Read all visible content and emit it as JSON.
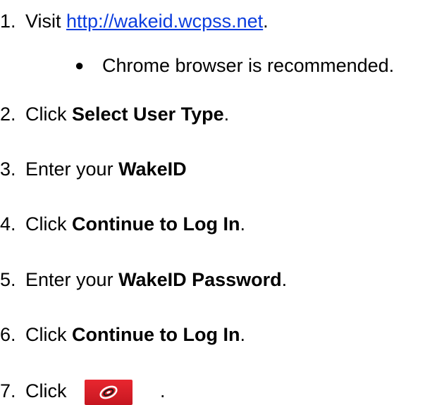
{
  "steps": [
    {
      "num": "1.",
      "pre": "Visit ",
      "link": "http://wakeid.wcpss.net",
      "post": "."
    },
    {
      "bullet": "Chrome browser is recommended."
    },
    {
      "num": "2.",
      "pre": "Click ",
      "bold": "Select User Type",
      "post": "."
    },
    {
      "num": "3.",
      "pre": "Enter your ",
      "bold": "WakeID",
      "post": ""
    },
    {
      "num": "4.",
      "pre": "Click ",
      "bold": "Continue to Log In",
      "post": "."
    },
    {
      "num": "5.",
      "pre": "Enter your ",
      "bold": "WakeID Password",
      "post": "."
    },
    {
      "num": "6.",
      "pre": "Click ",
      "bold": "Continue to Log In",
      "post": "."
    },
    {
      "num": "7.",
      "pre": "Click",
      "icon": "hurricanes-logo-icon",
      "post": "."
    }
  ],
  "colors": {
    "link": "#0b3dde",
    "icon_bg": "#d41e27"
  }
}
